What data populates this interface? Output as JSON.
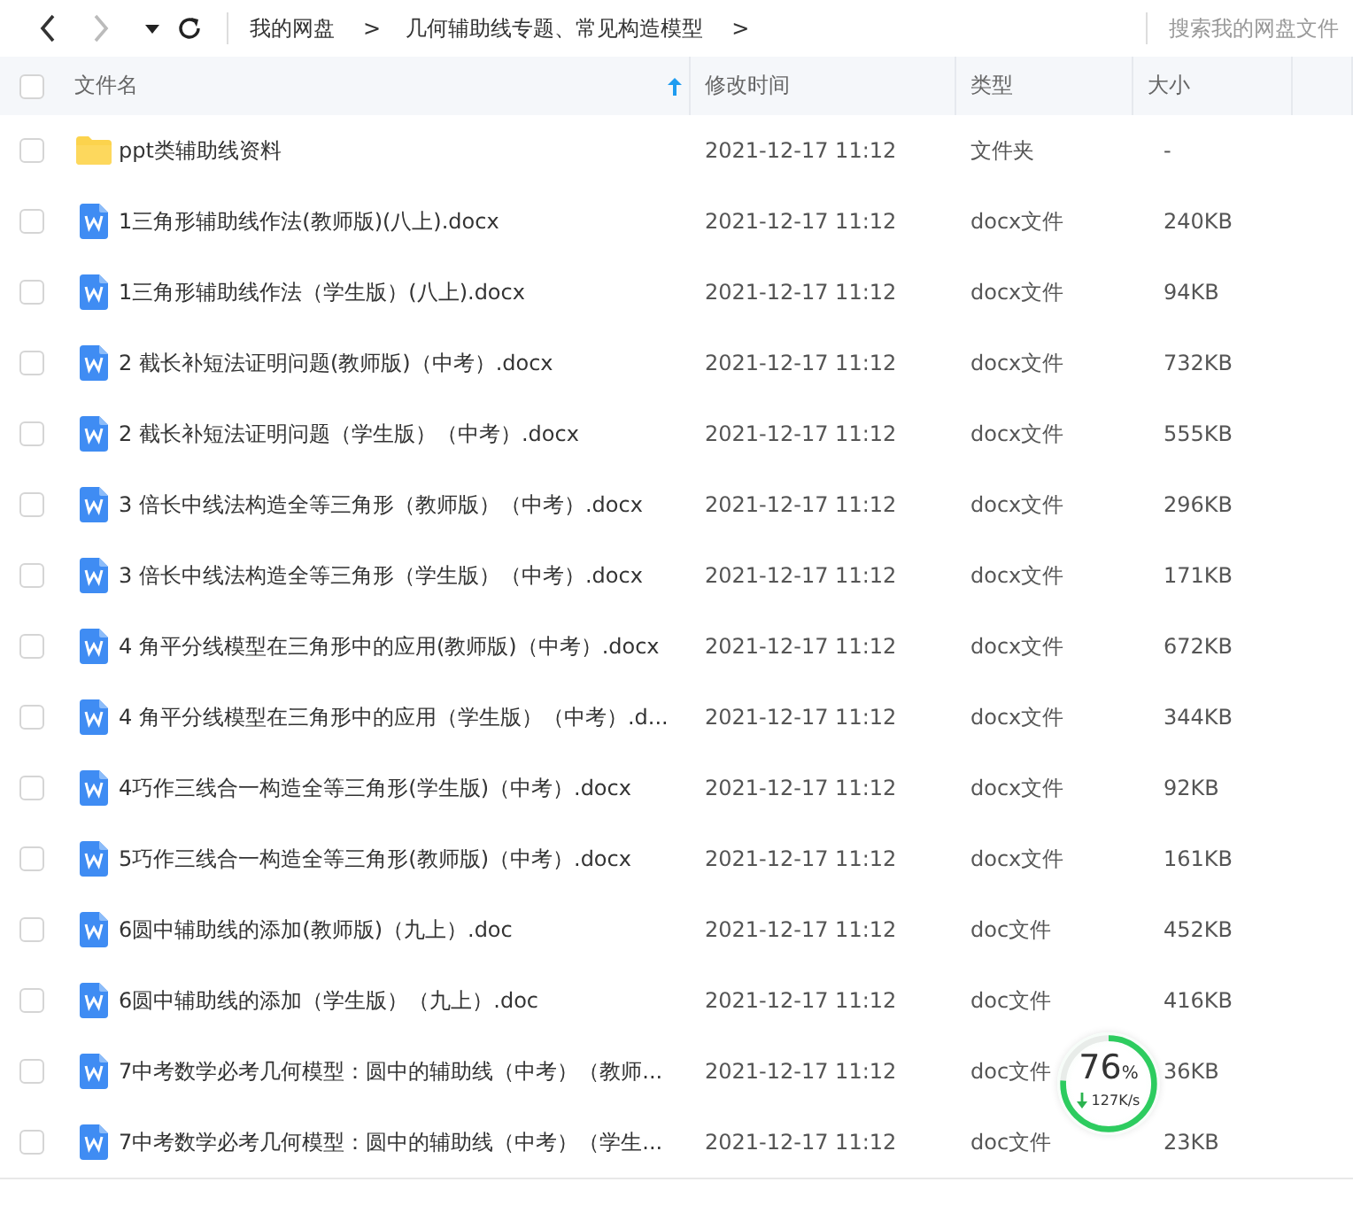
{
  "nav": {
    "back_disabled": false,
    "forward_disabled": true
  },
  "breadcrumbs": [
    {
      "label": "我的网盘",
      "sep": ">"
    },
    {
      "label": "几何辅助线专题、常见构造模型",
      "sep": ">"
    }
  ],
  "search": {
    "placeholder": "搜索我的网盘文件"
  },
  "table": {
    "select_all_checked": false,
    "columns": [
      {
        "label": "文件名",
        "sorted": true
      },
      {
        "label": "修改时间",
        "sorted": false
      },
      {
        "label": "类型",
        "sorted": false
      },
      {
        "label": "大小",
        "sorted": false
      }
    ],
    "rows": [
      {
        "kind": "folder",
        "name": "ppt类辅助线资料",
        "modified": "2021-12-17 11:12",
        "type": "文件夹",
        "size": "-",
        "checked": false
      },
      {
        "kind": "word",
        "name": "1三角形辅助线作法(教师版)(八上).docx",
        "modified": "2021-12-17 11:12",
        "type": "docx文件",
        "size": "240KB",
        "checked": false
      },
      {
        "kind": "word",
        "name": "1三角形辅助线作法（学生版）(八上).docx",
        "modified": "2021-12-17 11:12",
        "type": "docx文件",
        "size": "94KB",
        "checked": false
      },
      {
        "kind": "word",
        "name": "2  截长补短法证明问题(教师版)（中考）.docx",
        "modified": "2021-12-17 11:12",
        "type": "docx文件",
        "size": "732KB",
        "checked": false
      },
      {
        "kind": "word",
        "name": "2  截长补短法证明问题（学生版）（中考）.docx",
        "modified": "2021-12-17 11:12",
        "type": "docx文件",
        "size": "555KB",
        "checked": false
      },
      {
        "kind": "word",
        "name": "3 倍长中线法构造全等三角形（教师版）（中考）.docx",
        "modified": "2021-12-17 11:12",
        "type": "docx文件",
        "size": "296KB",
        "checked": false
      },
      {
        "kind": "word",
        "name": "3 倍长中线法构造全等三角形（学生版）（中考）.docx",
        "modified": "2021-12-17 11:12",
        "type": "docx文件",
        "size": "171KB",
        "checked": false
      },
      {
        "kind": "word",
        "name": "4 角平分线模型在三角形中的应用(教师版)（中考）.docx",
        "modified": "2021-12-17 11:12",
        "type": "docx文件",
        "size": "672KB",
        "checked": false
      },
      {
        "kind": "word",
        "name": "4 角平分线模型在三角形中的应用（学生版）（中考）.d...",
        "modified": "2021-12-17 11:12",
        "type": "docx文件",
        "size": "344KB",
        "checked": false
      },
      {
        "kind": "word",
        "name": "4巧作三线合一构造全等三角形(学生版)（中考）.docx",
        "modified": "2021-12-17 11:12",
        "type": "docx文件",
        "size": "92KB",
        "checked": false
      },
      {
        "kind": "word",
        "name": "5巧作三线合一构造全等三角形(教师版)（中考）.docx",
        "modified": "2021-12-17 11:12",
        "type": "docx文件",
        "size": "161KB",
        "checked": false
      },
      {
        "kind": "word",
        "name": "6圆中辅助线的添加(教师版)（九上）.doc",
        "modified": "2021-12-17 11:12",
        "type": "doc文件",
        "size": "452KB",
        "checked": false
      },
      {
        "kind": "word",
        "name": "6圆中辅助线的添加（学生版）（九上）.doc",
        "modified": "2021-12-17 11:12",
        "type": "doc文件",
        "size": "416KB",
        "checked": false
      },
      {
        "kind": "word",
        "name": "7中考数学必考几何模型：圆中的辅助线（中考）（教师...",
        "modified": "2021-12-17 11:12",
        "type": "doc文件",
        "size": "36KB",
        "checked": false
      },
      {
        "kind": "word",
        "name": "7中考数学必考几何模型：圆中的辅助线（中考）（学生...",
        "modified": "2021-12-17 11:12",
        "type": "doc文件",
        "size": "23KB",
        "checked": false
      }
    ]
  },
  "transfer": {
    "percent": "76",
    "unit": "%",
    "speed": "127K/s",
    "level": 0.76
  }
}
